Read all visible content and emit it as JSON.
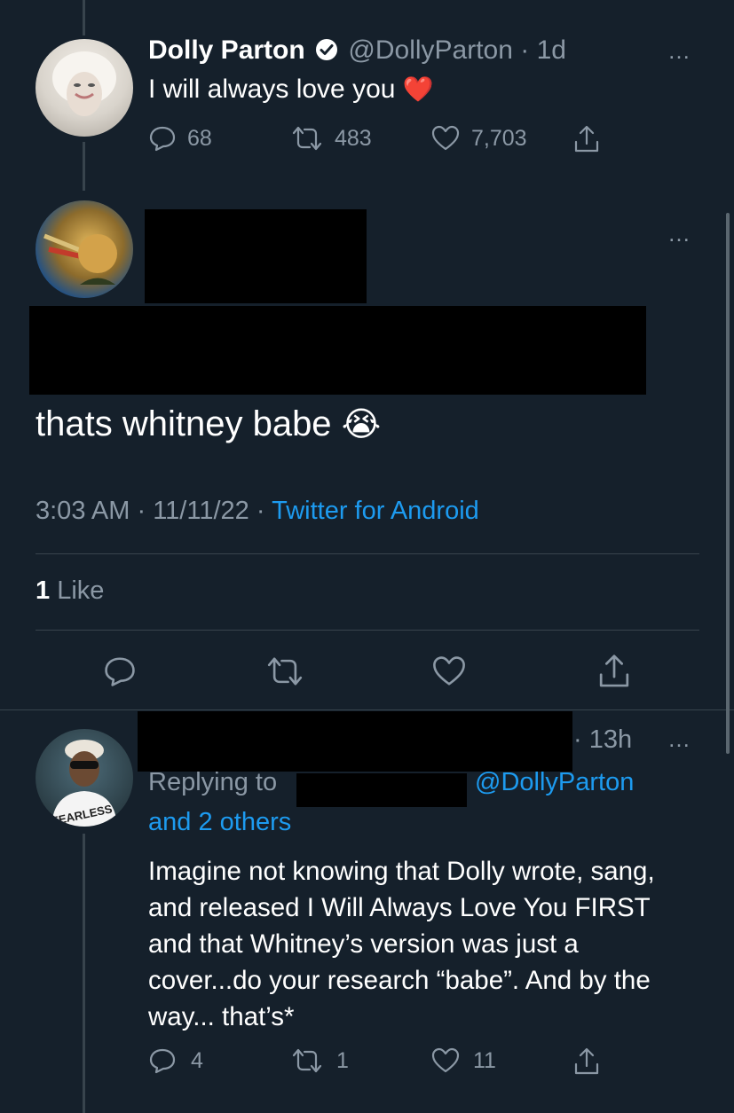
{
  "tweet1": {
    "display_name": "Dolly Parton",
    "handle": "@DollyParton",
    "separator": "·",
    "age": "1d",
    "text": "I will always love you",
    "emoji": "❤️",
    "replies": "68",
    "retweets": "483",
    "likes": "7,703",
    "more_icon": "…"
  },
  "tweet2": {
    "text": "thats whitney babe",
    "emoji": "😭",
    "time": "3:03 AM",
    "sep1": "·",
    "date": "11/11/22",
    "sep2": "·",
    "client": "Twitter for Android",
    "likes_count": "1",
    "likes_label": "Like",
    "more_icon": "…"
  },
  "tweet3": {
    "age": "13h",
    "age_sep": "·",
    "replying_label": "Replying to",
    "replying_handle": "@DollyParton",
    "replying_others": "and 2 others",
    "text": "Imagine not knowing that Dolly wrote, sang, and released I Will Always Love You FIRST and that Whitney’s version was just a cover...do your research “babe”. And by the way... that’s*",
    "replies": "4",
    "retweets": "1",
    "likes": "11",
    "more_icon": "…"
  },
  "colors": {
    "background": "#15202b",
    "text": "#ffffff",
    "muted": "#8b98a5",
    "link": "#1d9bf0",
    "divider": "#38444d",
    "heart": "#e0245e"
  }
}
